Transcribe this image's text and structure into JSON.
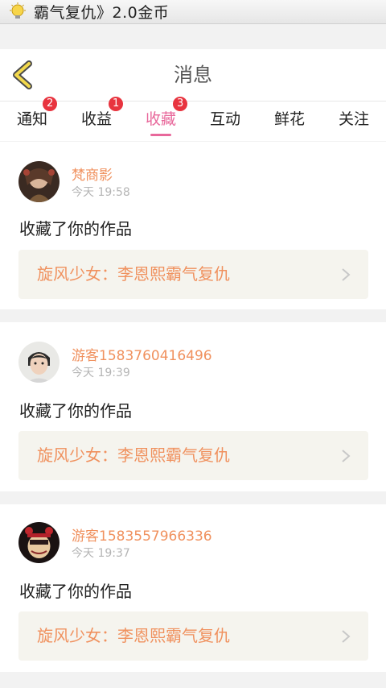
{
  "status_bar": {
    "notification_text": "霸气复仇》2.0金币",
    "icon": "lightbulb-icon"
  },
  "header": {
    "title": "消息",
    "back_icon": "chevron-left-icon"
  },
  "tabs": [
    {
      "label": "通知",
      "badge": "2"
    },
    {
      "label": "收益",
      "badge": "1"
    },
    {
      "label": "收藏",
      "badge": "3",
      "active": true
    },
    {
      "label": "互动"
    },
    {
      "label": "鲜花"
    },
    {
      "label": "关注"
    }
  ],
  "messages": [
    {
      "user": "梵商影",
      "time": "今天 19:58",
      "action": "收藏了你的作品",
      "work": "旋风少女：李恩熙霸气复仇"
    },
    {
      "user": "游客1583760416496",
      "time": "今天 19:39",
      "action": "收藏了你的作品",
      "work": "旋风少女：李恩熙霸气复仇"
    },
    {
      "user": "游客1583557966336",
      "time": "今天 19:37",
      "action": "收藏了你的作品",
      "work": "旋风少女：李恩熙霸气复仇"
    }
  ],
  "colors": {
    "accent_pink": "#e8689b",
    "name_orange": "#f0915e",
    "badge_red": "#e8343f"
  }
}
